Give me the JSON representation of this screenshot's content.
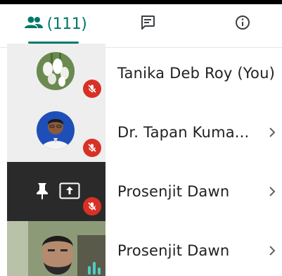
{
  "tabs": {
    "people_count": "(111)",
    "people_icon": "people-icon",
    "chat_icon": "chat-icon",
    "info_icon": "info-icon"
  },
  "participants": [
    {
      "name": "Tanika Deb Roy (You)",
      "muted": true,
      "has_chevron": false
    },
    {
      "name": "Dr. Tapan Kuma...",
      "muted": true,
      "has_chevron": true
    },
    {
      "name": "Prosenjit Dawn",
      "muted": true,
      "has_chevron": true,
      "icons": [
        "pin-icon",
        "present-icon"
      ]
    },
    {
      "name": "Prosenjit Dawn",
      "muted": false,
      "has_chevron": true,
      "speaking": true
    }
  ],
  "colors": {
    "accent": "#00796b",
    "mute_red": "#d93025",
    "speaking": "#4ecdc4"
  }
}
